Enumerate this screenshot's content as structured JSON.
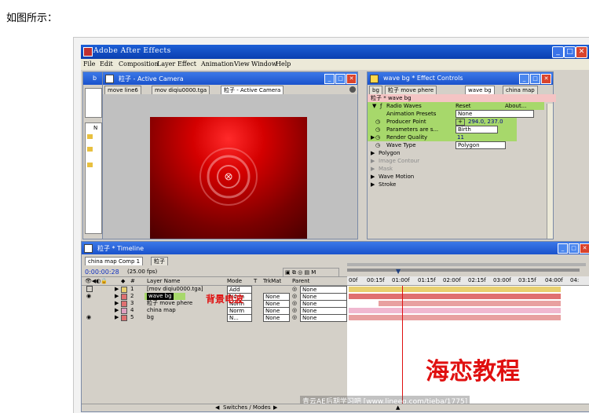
{
  "caption": "如图所示：",
  "app": {
    "title": "Adobe After Effects",
    "menu": [
      "File",
      "Edit",
      "Composition",
      "Layer",
      "Effect",
      "Animation",
      "View",
      "Window",
      "Help"
    ]
  },
  "project_panel": {
    "title": "b",
    "items": [
      "N"
    ]
  },
  "comp_panel": {
    "title": "粒子 - Active Camera",
    "tabs": [
      "move line6",
      "mov diqiu0000.tga",
      "粒子 - Active Camera"
    ]
  },
  "effects_panel": {
    "title": "wave bg * Effect Controls",
    "tabs": [
      "bg",
      "粒子 move phere",
      "wave bg",
      "china map"
    ],
    "header": "粒子 * wave bg",
    "effect_name": "Radio Waves",
    "reset": "Reset",
    "about": "About...",
    "rows": [
      {
        "label": "Animation Presets",
        "value": "None"
      },
      {
        "label": "Producer Point",
        "value": "294.0, 237.0"
      },
      {
        "label": "Parameters are s...",
        "value": "Birth"
      },
      {
        "label": "Render Quality",
        "value": "11"
      },
      {
        "label": "Wave Type",
        "value": "Polygon"
      },
      {
        "label": "Polygon",
        "value": ""
      },
      {
        "label": "Image Contour",
        "value": ""
      },
      {
        "label": "Mask",
        "value": ""
      },
      {
        "label": "Wave Motion",
        "value": ""
      },
      {
        "label": "Stroke",
        "value": ""
      }
    ]
  },
  "timeline": {
    "title": "粒子 * Timeline",
    "tabs": [
      "china map Comp 1",
      "粒子"
    ],
    "timecode": "0:00:00:28",
    "fps": "(25.00 fps)",
    "col_headers": {
      "num": "#",
      "layer": "Layer Name",
      "mode": "Mode",
      "t": "T",
      "trkmat": "TrkMat",
      "parent": "Parent"
    },
    "ruler": [
      "00f",
      "00:15f",
      "01:00f",
      "01:15f",
      "02:00f",
      "02:15f",
      "03:00f",
      "03:15f",
      "04:00f",
      "04:"
    ],
    "switches": "Switches / Modes",
    "layers": [
      {
        "num": "1",
        "name": "[mov diqiu0000.tga]",
        "mode": "Add",
        "trkmat": "",
        "parent": "None"
      },
      {
        "num": "2",
        "name": "wave bg",
        "mode": "Norm",
        "trkmat": "None",
        "parent": "None"
      },
      {
        "num": "3",
        "name": "粒子 move phere",
        "mode": "Norm",
        "trkmat": "None",
        "parent": "None"
      },
      {
        "num": "4",
        "name": "china map",
        "mode": "Norm",
        "trkmat": "None",
        "parent": "None"
      },
      {
        "num": "5",
        "name": "bg",
        "mode": "N...",
        "trkmat": "None",
        "parent": "None"
      }
    ]
  },
  "annotation": "背景电波",
  "watermark_big": "海恋教程",
  "watermark_url": "青云AE后期学习吧 [www.lineeg.com/tieba/1775]",
  "colors": {
    "accent": "#0a3fb0",
    "comp_red": "#d40000",
    "annotation_red": "#e01010"
  }
}
